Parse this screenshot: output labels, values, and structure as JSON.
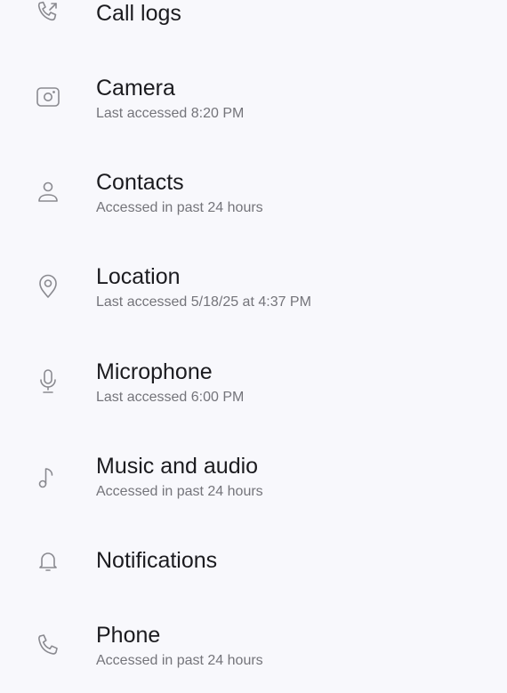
{
  "permissions": [
    {
      "icon": "call-log-icon",
      "title": "Call logs",
      "subtitle": ""
    },
    {
      "icon": "camera-icon",
      "title": "Camera",
      "subtitle": "Last accessed 8:20 PM"
    },
    {
      "icon": "person-icon",
      "title": "Contacts",
      "subtitle": "Accessed in past 24 hours"
    },
    {
      "icon": "location-pin-icon",
      "title": "Location",
      "subtitle": "Last accessed 5/18/25 at 4:37 PM"
    },
    {
      "icon": "microphone-icon",
      "title": "Microphone",
      "subtitle": "Last accessed 6:00 PM"
    },
    {
      "icon": "music-note-icon",
      "title": "Music and audio",
      "subtitle": "Accessed in past 24 hours"
    },
    {
      "icon": "bell-icon",
      "title": "Notifications",
      "subtitle": ""
    },
    {
      "icon": "phone-icon",
      "title": "Phone",
      "subtitle": "Accessed in past 24 hours"
    }
  ],
  "colors": {
    "background": "#f8f8fc",
    "title": "#1b1b1f",
    "subtitle": "#74747a",
    "icon": "#8a8a90"
  }
}
